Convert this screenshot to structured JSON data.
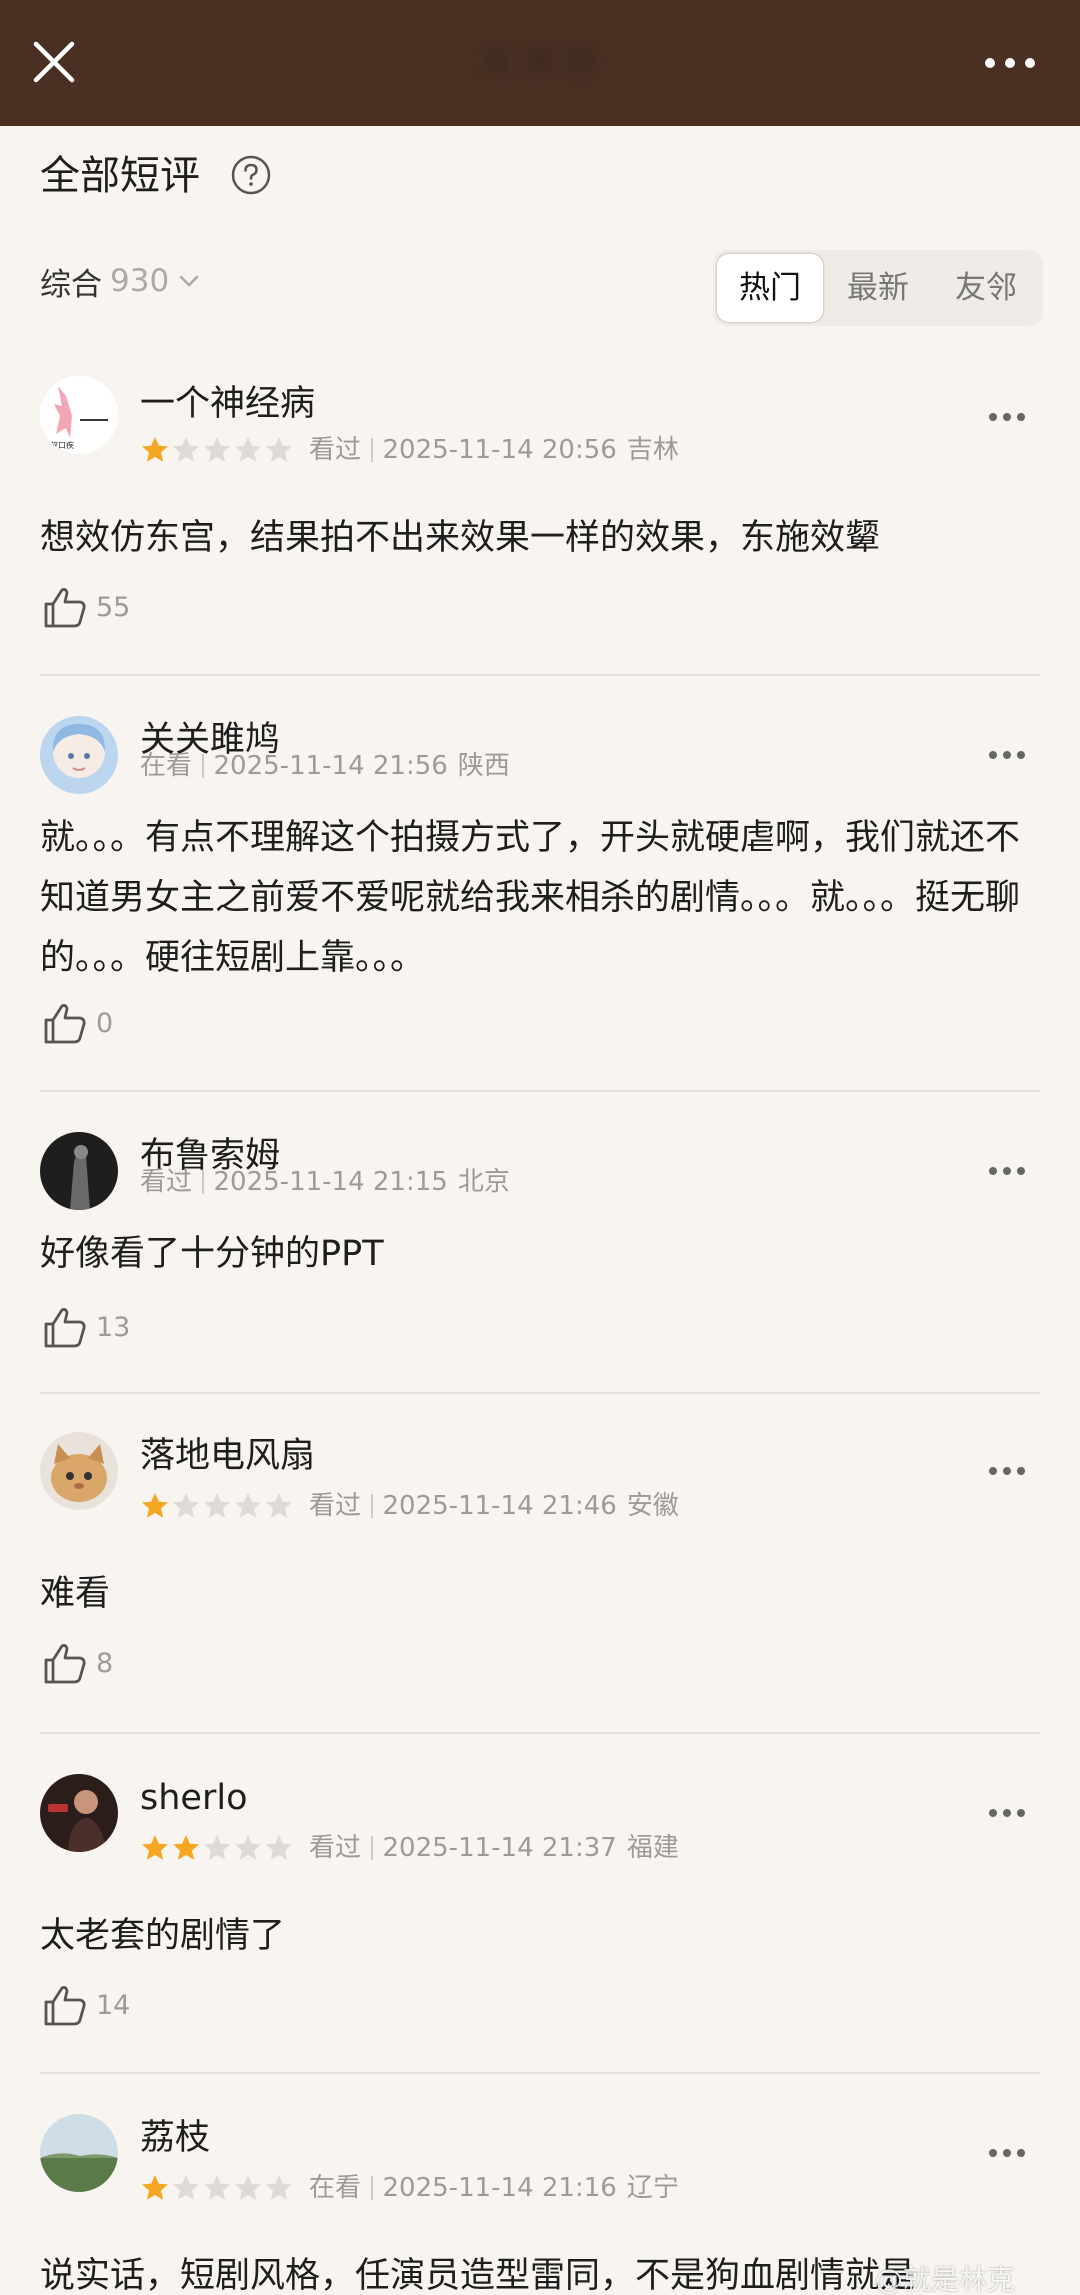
{
  "header": {
    "title": "某某剧",
    "close_icon": "close-icon",
    "more_icon": "more-horizontal-icon",
    "bg_color": "#4a3023"
  },
  "section": {
    "title": "全部短评",
    "help_icon": "question-circle-icon"
  },
  "sort": {
    "label": "综合",
    "count": "930"
  },
  "tabs": [
    {
      "label": "热门",
      "active": true
    },
    {
      "label": "最新",
      "active": false
    },
    {
      "label": "友邻",
      "active": false
    }
  ],
  "colors": {
    "star_filled": "#f5a623",
    "star_empty": "#dedad5",
    "accent_brown": "#4a3023"
  },
  "reviews": [
    {
      "user": "一个神经病",
      "stars": 1,
      "status": "看过",
      "time": "2025-11-14 20:56",
      "location": "吉林",
      "text": "想效仿东宫，结果拍不出来效果一样的效果，东施效颦",
      "likes": "55"
    },
    {
      "user": "关关雎鸠",
      "stars": 0,
      "status": "在看",
      "time": "2025-11-14 21:56",
      "location": "陕西",
      "text": "就。。。有点不理解这个拍摄方式了，开头就硬虐啊，我们就还不知道男女主之前爱不爱呢就给我来相杀的剧情。。。就。。。挺无聊的。。。硬往短剧上靠。。。",
      "likes": "0"
    },
    {
      "user": "布鲁索姆",
      "stars": 0,
      "status": "看过",
      "time": "2025-11-14 21:15",
      "location": "北京",
      "text": "好像看了十分钟的PPT",
      "likes": "13"
    },
    {
      "user": "落地电风扇",
      "stars": 1,
      "status": "看过",
      "time": "2025-11-14 21:46",
      "location": "安徽",
      "text": "难看",
      "likes": "8"
    },
    {
      "user": "sherlo",
      "stars": 2,
      "status": "看过",
      "time": "2025-11-14 21:37",
      "location": "福建",
      "text": "太老套的剧情了",
      "likes": "14"
    },
    {
      "user": "荔枝",
      "stars": 1,
      "status": "在看",
      "time": "2025-11-14 21:16",
      "location": "辽宁",
      "text": "说实话，短剧风格，任演员造型雷同，不是狗血剧情就是",
      "likes": ""
    }
  ],
  "watermark": "@就是林克"
}
